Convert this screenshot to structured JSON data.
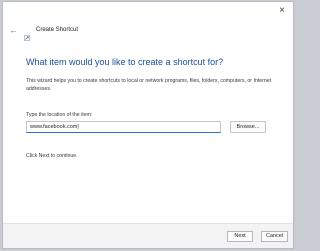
{
  "window": {
    "title": "Create Shortcut",
    "close_symbol": "×",
    "back_symbol": "←"
  },
  "icons": {
    "close": "close-icon",
    "back": "back-arrow-icon",
    "wizard": "shortcut-wizard-icon"
  },
  "main": {
    "heading": "What item would you like to create a shortcut for?",
    "description": "This wizard helps you to create shortcuts to local or network programs, files, folders, computers, or Internet addresses.",
    "location_label": "Type the location of the item:",
    "location_value": "www.facebook.com|",
    "browse_label": "Browse...",
    "hint": "Click Next to continue."
  },
  "footer": {
    "next_label": "Next",
    "cancel_label": "Cancel"
  },
  "colors": {
    "heading": "#1a4f9c",
    "input_focus": "#2f6fc7",
    "background": "#c9ccd3"
  }
}
